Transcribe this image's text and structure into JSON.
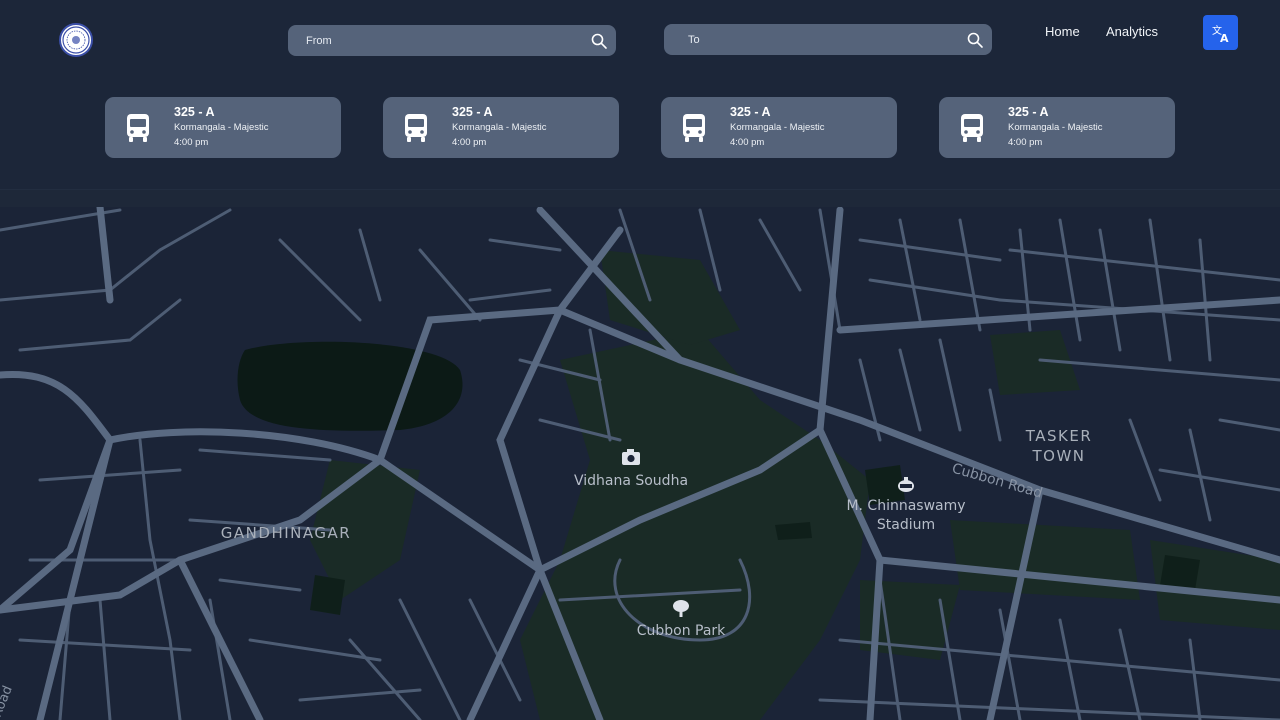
{
  "header": {
    "from_placeholder": "From",
    "to_placeholder": "To",
    "nav": {
      "home": "Home",
      "analytics": "Analytics"
    },
    "translate_icon": "translate-icon",
    "logo_icon": "emblem-logo"
  },
  "routes": [
    {
      "number": "325 - A",
      "path": "Kormangala - Majestic",
      "time": "4:00 pm"
    },
    {
      "number": "325 - A",
      "path": "Kormangala - Majestic",
      "time": "4:00 pm"
    },
    {
      "number": "325 - A",
      "path": "Kormangala - Majestic",
      "time": "4:00 pm"
    },
    {
      "number": "325 - A",
      "path": "Kormangala - Majestic",
      "time": "4:00 pm"
    }
  ],
  "map": {
    "labels": {
      "vidhana_soudha": "Vidhana Soudha",
      "gandhinagar": "GANDHINAGAR",
      "cubbon_park": "Cubbon Park",
      "stadium_line1": "M. Chinnaswamy",
      "stadium_line2": "Stadium",
      "tasker_line1": "TASKER",
      "tasker_line2": "TOWN",
      "cubbon_road": "Cubbon Road",
      "edge_road": "Road"
    }
  },
  "colors": {
    "accent": "#2563eb",
    "card": "#55637a",
    "header_bg": "#1c2639",
    "map_bg": "#1b2437",
    "road": "#5a6a82",
    "park": "#1a2b26"
  }
}
